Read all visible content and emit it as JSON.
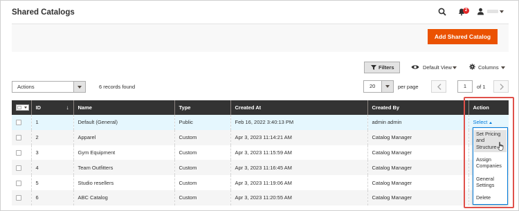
{
  "header": {
    "title": "Shared Catalogs",
    "notification_count": "2",
    "icons": [
      "search-icon",
      "bell-icon",
      "user-icon"
    ]
  },
  "action_bar": {
    "add_button_label": "Add Shared Catalog",
    "accent": "#eb5202"
  },
  "toolbar": {
    "filters_label": "Filters",
    "view_label": "Default View",
    "columns_label": "Columns",
    "actions_label": "Actions",
    "records_found": "6 records found",
    "per_page_value": "20",
    "per_page_label": "per page",
    "page_value": "1",
    "page_of": "of 1"
  },
  "table": {
    "columns": [
      "ID",
      "Name",
      "Type",
      "Created At",
      "Created By",
      "Action"
    ],
    "rows": [
      {
        "id": "1",
        "name": "Default (General)",
        "type": "Public",
        "created_at": "Feb 16, 2022 3:40:13 PM",
        "created_by": "admin admin"
      },
      {
        "id": "2",
        "name": "Apparel",
        "type": "Custom",
        "created_at": "Apr 3, 2023 11:14:21 AM",
        "created_by": "Catalog Manager"
      },
      {
        "id": "3",
        "name": "Gym Equipment",
        "type": "Custom",
        "created_at": "Apr 3, 2023 11:15:59 AM",
        "created_by": "Catalog Manager"
      },
      {
        "id": "4",
        "name": "Team Outfitters",
        "type": "Custom",
        "created_at": "Apr 3, 2023 11:16:45 AM",
        "created_by": "Catalog Manager"
      },
      {
        "id": "5",
        "name": "Studio resellers",
        "type": "Custom",
        "created_at": "Apr 3, 2023 11:19:06 AM",
        "created_by": "Catalog Manager"
      },
      {
        "id": "6",
        "name": "ABC Catalog",
        "type": "Custom",
        "created_at": "Apr 3, 2023 11:20:55 AM",
        "created_by": "Catalog Manager"
      }
    ],
    "action_select_label": "Select"
  },
  "action_menu": {
    "items": [
      {
        "line1": "Set Pricing",
        "line2": "and",
        "line3": "Structure"
      },
      {
        "line1": "Assign",
        "line2": "Companies"
      },
      {
        "line1": "General",
        "line2": "Settings"
      },
      {
        "line1": "Delete"
      }
    ]
  },
  "colors": {
    "header_bg": "#333333",
    "link": "#007bdb",
    "highlight_row": "#e5f7fe",
    "callout": "#e0504a"
  }
}
